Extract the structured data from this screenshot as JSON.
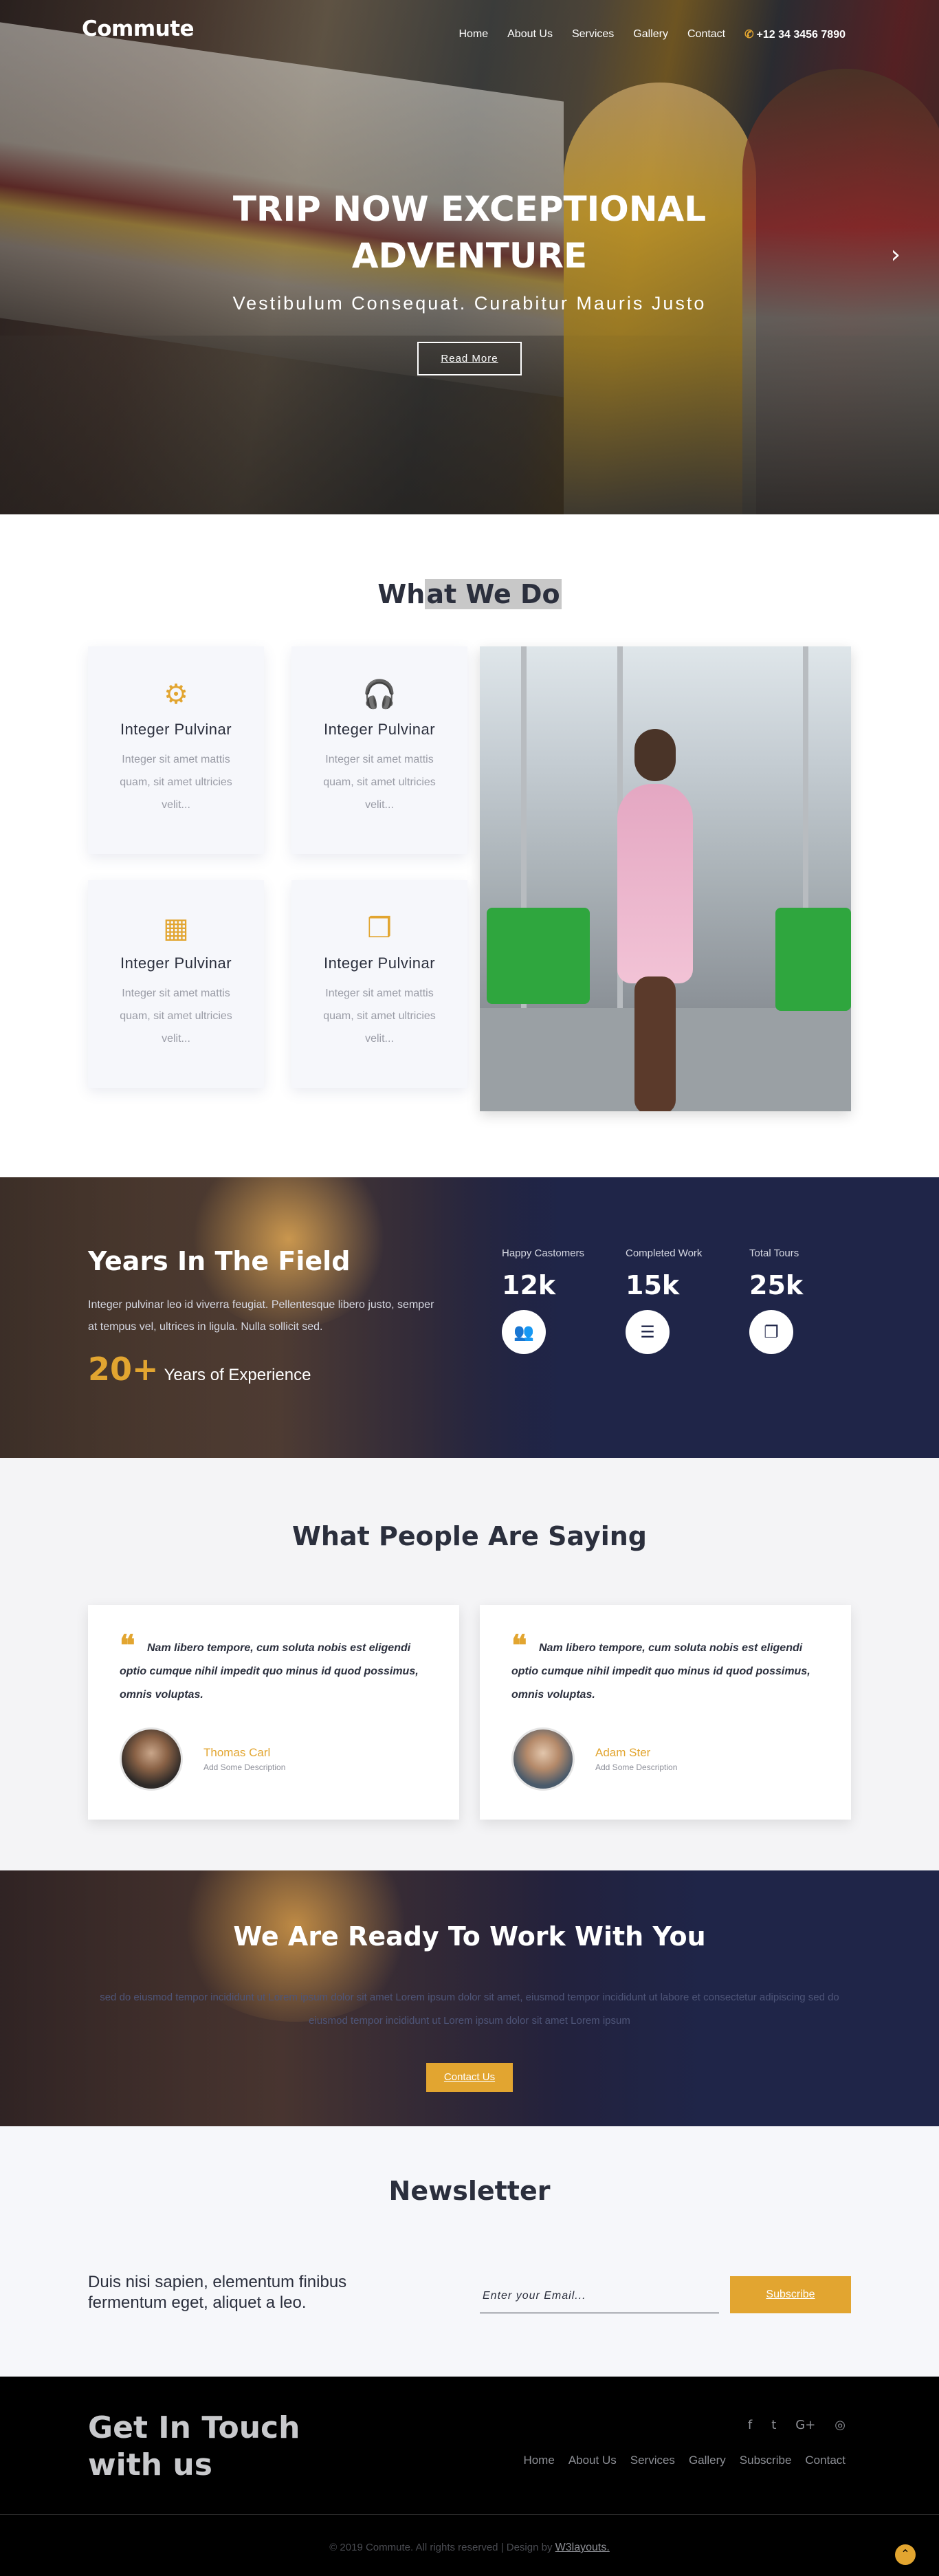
{
  "brand": "Commute",
  "nav": {
    "items": [
      "Home",
      "About Us",
      "Services",
      "Gallery",
      "Contact"
    ],
    "phone": "+12 34 3456 7890"
  },
  "hero": {
    "title": "TRIP NOW EXCEPTIONAL ADVENTURE",
    "subtitle": "Vestibulum Consequat. Curabitur Mauris Justo",
    "button": "Read More",
    "next_icon": "chevron-right-icon"
  },
  "what_we_do": {
    "title_pre": "Wh",
    "title_hl": "at We Do",
    "cards": [
      {
        "icon": "gears-icon",
        "title": "Integer Pulvinar",
        "desc": "Integer sit amet mattis quam, sit amet ultricies velit..."
      },
      {
        "icon": "headphones-icon",
        "title": "Integer Pulvinar",
        "desc": "Integer sit amet mattis quam, sit amet ultricies velit..."
      },
      {
        "icon": "calendar-icon",
        "title": "Integer Pulvinar",
        "desc": "Integer sit amet mattis quam, sit amet ultricies velit..."
      },
      {
        "icon": "boxes-icon",
        "title": "Integer Pulvinar",
        "desc": "Integer sit amet mattis quam, sit amet ultricies velit..."
      }
    ]
  },
  "years": {
    "title": "Years In The Field",
    "text": "Integer pulvinar leo id viverra feugiat. Pellentesque libero justo, semper at tempus vel, ultrices in ligula. Nulla sollicit sed.",
    "exp_num": "20+",
    "exp_label": "Years of Experience",
    "stats": [
      {
        "label": "Happy Castomers",
        "value": "12k",
        "icon": "users-icon"
      },
      {
        "label": "Completed Work",
        "value": "15k",
        "icon": "list-icon"
      },
      {
        "label": "Total Tours",
        "value": "25k",
        "icon": "copy-icon"
      }
    ]
  },
  "testimonials": {
    "title": "What People Are Saying",
    "items": [
      {
        "quote": "Nam libero tempore, cum soluta nobis est eligendi optio cumque nihil impedit quo minus id quod possimus, omnis voluptas.",
        "name": "Thomas Carl",
        "desc": "Add Some Description"
      },
      {
        "quote": "Nam libero tempore, cum soluta nobis est eligendi optio cumque nihil impedit quo minus id quod possimus, omnis voluptas.",
        "name": "Adam Ster",
        "desc": "Add Some Description"
      }
    ]
  },
  "ready": {
    "title": "We Are Ready To Work With You",
    "text": "sed do eiusmod tempor incididunt ut Lorem ipsum dolor sit amet Lorem ipsum dolor sit amet, eiusmod tempor incididunt ut labore et consectetur adipiscing sed do eiusmod tempor incididunt ut Lorem ipsum dolor sit amet Lorem ipsum",
    "button": "Contact Us"
  },
  "newsletter": {
    "title": "Newsletter",
    "text": "Duis nisi sapien, elementum finibus fermentum eget, aliquet a leo.",
    "placeholder": "Enter your Email...",
    "button": "Subscribe"
  },
  "footer": {
    "title_line1": "Get In Touch",
    "title_line2": "with us",
    "social": [
      "f",
      "t",
      "G+",
      "◎"
    ],
    "links": [
      "Home",
      "About Us",
      "Services",
      "Gallery",
      "Subscribe",
      "Contact"
    ],
    "copyright": "© 2019 Commute. All rights reserved | Design by ",
    "designer": "W3layouts."
  },
  "colors": {
    "accent": "#e2a530",
    "navy": "#1f2548",
    "text": "#2b2f3d"
  }
}
